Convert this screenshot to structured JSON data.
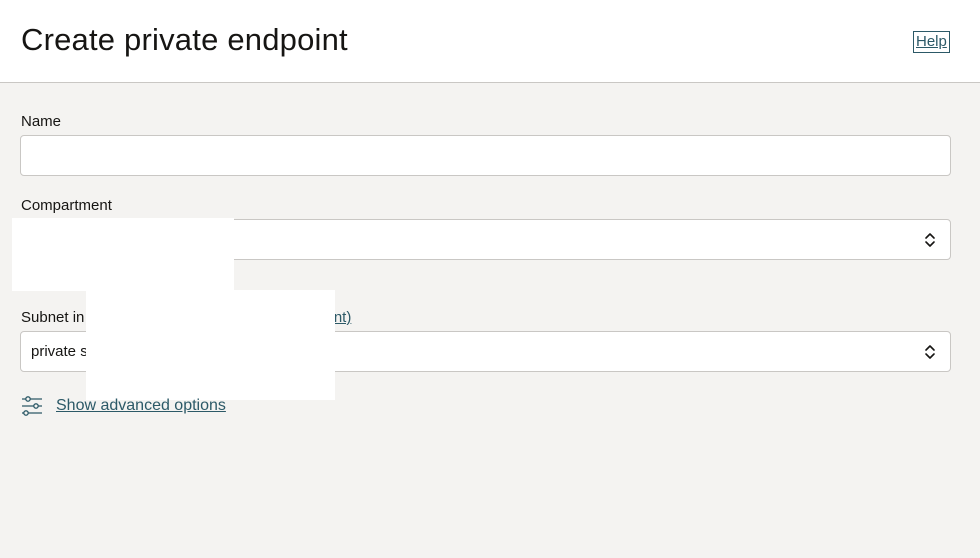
{
  "header": {
    "title": "Create private endpoint",
    "help_label": "Help"
  },
  "form": {
    "name": {
      "label": "Name",
      "value": "",
      "placeholder": ""
    },
    "compartment": {
      "label": "Compartment",
      "value": ""
    },
    "subnet": {
      "label": "Subnet in",
      "change_link": "ment)",
      "value": "private s"
    }
  },
  "advanced": {
    "label": "Show advanced options",
    "icon": "sliders-icon"
  },
  "colors": {
    "link": "#2c5967",
    "background": "#f4f3f1",
    "header_bg": "#ffffff",
    "border": "#c9c7c4"
  }
}
